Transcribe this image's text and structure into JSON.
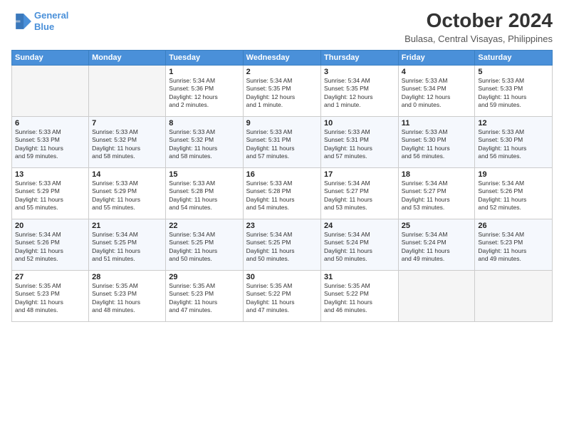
{
  "header": {
    "logo_line1": "General",
    "logo_line2": "Blue",
    "month": "October 2024",
    "location": "Bulasa, Central Visayas, Philippines"
  },
  "weekdays": [
    "Sunday",
    "Monday",
    "Tuesday",
    "Wednesday",
    "Thursday",
    "Friday",
    "Saturday"
  ],
  "weeks": [
    [
      {
        "day": "",
        "info": ""
      },
      {
        "day": "",
        "info": ""
      },
      {
        "day": "1",
        "info": "Sunrise: 5:34 AM\nSunset: 5:36 PM\nDaylight: 12 hours\nand 2 minutes."
      },
      {
        "day": "2",
        "info": "Sunrise: 5:34 AM\nSunset: 5:35 PM\nDaylight: 12 hours\nand 1 minute."
      },
      {
        "day": "3",
        "info": "Sunrise: 5:34 AM\nSunset: 5:35 PM\nDaylight: 12 hours\nand 1 minute."
      },
      {
        "day": "4",
        "info": "Sunrise: 5:33 AM\nSunset: 5:34 PM\nDaylight: 12 hours\nand 0 minutes."
      },
      {
        "day": "5",
        "info": "Sunrise: 5:33 AM\nSunset: 5:33 PM\nDaylight: 11 hours\nand 59 minutes."
      }
    ],
    [
      {
        "day": "6",
        "info": "Sunrise: 5:33 AM\nSunset: 5:33 PM\nDaylight: 11 hours\nand 59 minutes."
      },
      {
        "day": "7",
        "info": "Sunrise: 5:33 AM\nSunset: 5:32 PM\nDaylight: 11 hours\nand 58 minutes."
      },
      {
        "day": "8",
        "info": "Sunrise: 5:33 AM\nSunset: 5:32 PM\nDaylight: 11 hours\nand 58 minutes."
      },
      {
        "day": "9",
        "info": "Sunrise: 5:33 AM\nSunset: 5:31 PM\nDaylight: 11 hours\nand 57 minutes."
      },
      {
        "day": "10",
        "info": "Sunrise: 5:33 AM\nSunset: 5:31 PM\nDaylight: 11 hours\nand 57 minutes."
      },
      {
        "day": "11",
        "info": "Sunrise: 5:33 AM\nSunset: 5:30 PM\nDaylight: 11 hours\nand 56 minutes."
      },
      {
        "day": "12",
        "info": "Sunrise: 5:33 AM\nSunset: 5:30 PM\nDaylight: 11 hours\nand 56 minutes."
      }
    ],
    [
      {
        "day": "13",
        "info": "Sunrise: 5:33 AM\nSunset: 5:29 PM\nDaylight: 11 hours\nand 55 minutes."
      },
      {
        "day": "14",
        "info": "Sunrise: 5:33 AM\nSunset: 5:29 PM\nDaylight: 11 hours\nand 55 minutes."
      },
      {
        "day": "15",
        "info": "Sunrise: 5:33 AM\nSunset: 5:28 PM\nDaylight: 11 hours\nand 54 minutes."
      },
      {
        "day": "16",
        "info": "Sunrise: 5:33 AM\nSunset: 5:28 PM\nDaylight: 11 hours\nand 54 minutes."
      },
      {
        "day": "17",
        "info": "Sunrise: 5:34 AM\nSunset: 5:27 PM\nDaylight: 11 hours\nand 53 minutes."
      },
      {
        "day": "18",
        "info": "Sunrise: 5:34 AM\nSunset: 5:27 PM\nDaylight: 11 hours\nand 53 minutes."
      },
      {
        "day": "19",
        "info": "Sunrise: 5:34 AM\nSunset: 5:26 PM\nDaylight: 11 hours\nand 52 minutes."
      }
    ],
    [
      {
        "day": "20",
        "info": "Sunrise: 5:34 AM\nSunset: 5:26 PM\nDaylight: 11 hours\nand 52 minutes."
      },
      {
        "day": "21",
        "info": "Sunrise: 5:34 AM\nSunset: 5:25 PM\nDaylight: 11 hours\nand 51 minutes."
      },
      {
        "day": "22",
        "info": "Sunrise: 5:34 AM\nSunset: 5:25 PM\nDaylight: 11 hours\nand 50 minutes."
      },
      {
        "day": "23",
        "info": "Sunrise: 5:34 AM\nSunset: 5:25 PM\nDaylight: 11 hours\nand 50 minutes."
      },
      {
        "day": "24",
        "info": "Sunrise: 5:34 AM\nSunset: 5:24 PM\nDaylight: 11 hours\nand 50 minutes."
      },
      {
        "day": "25",
        "info": "Sunrise: 5:34 AM\nSunset: 5:24 PM\nDaylight: 11 hours\nand 49 minutes."
      },
      {
        "day": "26",
        "info": "Sunrise: 5:34 AM\nSunset: 5:23 PM\nDaylight: 11 hours\nand 49 minutes."
      }
    ],
    [
      {
        "day": "27",
        "info": "Sunrise: 5:35 AM\nSunset: 5:23 PM\nDaylight: 11 hours\nand 48 minutes."
      },
      {
        "day": "28",
        "info": "Sunrise: 5:35 AM\nSunset: 5:23 PM\nDaylight: 11 hours\nand 48 minutes."
      },
      {
        "day": "29",
        "info": "Sunrise: 5:35 AM\nSunset: 5:23 PM\nDaylight: 11 hours\nand 47 minutes."
      },
      {
        "day": "30",
        "info": "Sunrise: 5:35 AM\nSunset: 5:22 PM\nDaylight: 11 hours\nand 47 minutes."
      },
      {
        "day": "31",
        "info": "Sunrise: 5:35 AM\nSunset: 5:22 PM\nDaylight: 11 hours\nand 46 minutes."
      },
      {
        "day": "",
        "info": ""
      },
      {
        "day": "",
        "info": ""
      }
    ]
  ]
}
